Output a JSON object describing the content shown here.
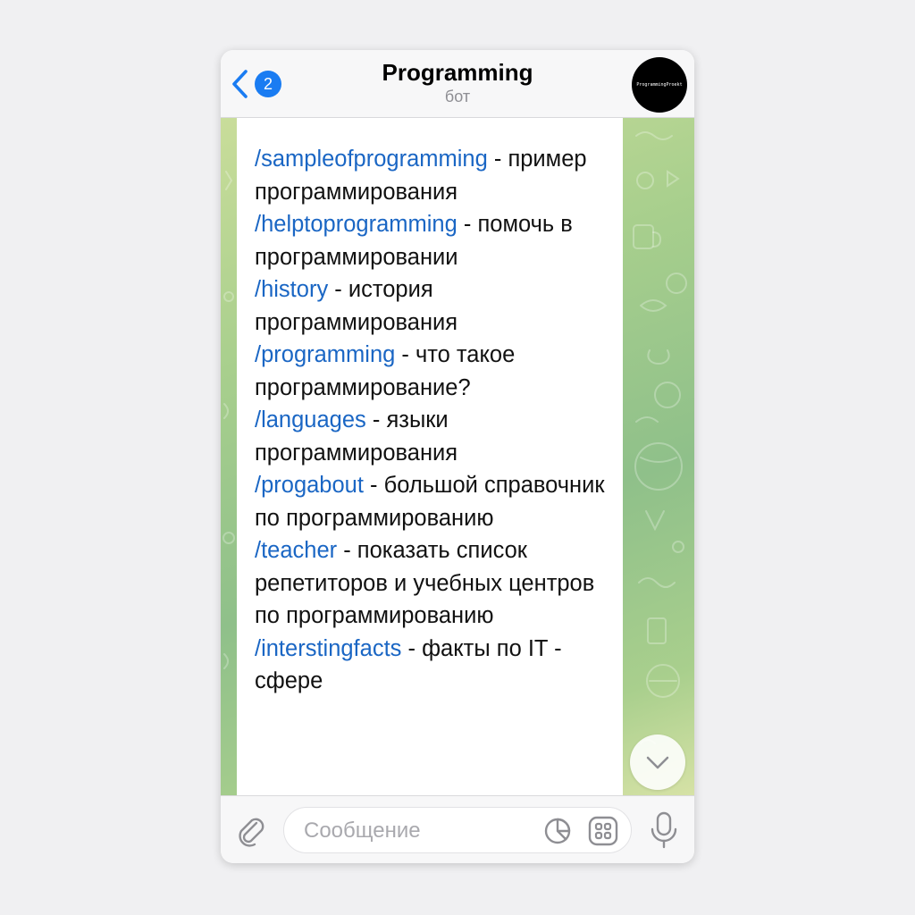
{
  "header": {
    "back_badge": "2",
    "title": "Programming",
    "subtitle": "бот",
    "avatar_text": "ProgrammingProekt"
  },
  "message": {
    "lines": [
      {
        "command": "/sampleofprogramming",
        "text": " - пример программирования"
      },
      {
        "command": "/helptoprogramming",
        "text": " - помочь в программировании"
      },
      {
        "command": "/history",
        "text": " - история программирования"
      },
      {
        "command": "/programming",
        "text": " - что такое программирование?"
      },
      {
        "command": "/languages",
        "text": " - языки программирования"
      },
      {
        "command": "/progabout",
        "text": " - большой справочник по программированию"
      },
      {
        "command": "/teacher",
        "text": " - показать список репетиторов и учебных центров по программированию"
      },
      {
        "command": "/interstingfacts",
        "text": " - факты по IT - сфере"
      }
    ]
  },
  "composer": {
    "placeholder": "Сообщение"
  },
  "colors": {
    "accent": "#1a7cf2",
    "command_link": "#1a66c4",
    "wallpaper_green": "#8fc08a"
  },
  "icons": [
    "chevron-left-icon",
    "paperclip-icon",
    "sticker-icon",
    "keyboard-grid-icon",
    "microphone-icon",
    "chevron-down-icon"
  ]
}
